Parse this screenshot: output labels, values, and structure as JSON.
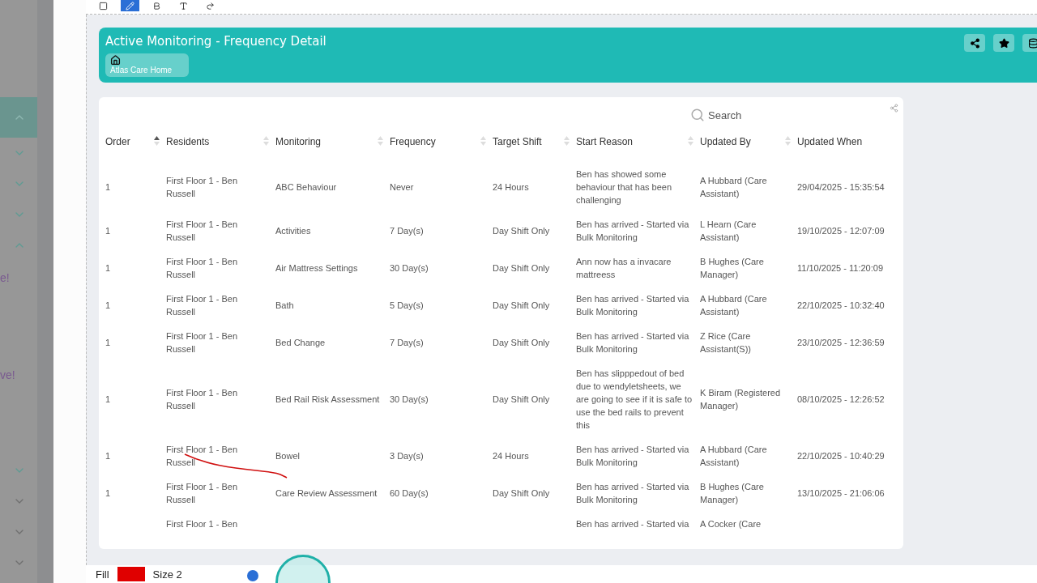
{
  "sidebar": {
    "items": [
      {
        "kind": "toggle",
        "expanded": true,
        "selected": true
      },
      {
        "kind": "toggle",
        "expanded": false,
        "selected": false
      },
      {
        "kind": "toggle",
        "expanded": false,
        "selected": false
      },
      {
        "kind": "toggle",
        "expanded": false,
        "selected": false
      },
      {
        "kind": "toggle",
        "expanded": true,
        "selected": false
      },
      {
        "kind": "text",
        "label": "e!"
      },
      {
        "kind": "text",
        "label": "ve!"
      },
      {
        "kind": "toggle",
        "expanded": false,
        "selected": false
      },
      {
        "kind": "toggle",
        "expanded": false,
        "selected": false
      },
      {
        "kind": "toggle",
        "expanded": false,
        "selected": false
      },
      {
        "kind": "toggle",
        "expanded": false,
        "selected": false
      }
    ]
  },
  "toolbar": {
    "tools": [
      {
        "kind": "square",
        "selected": false
      },
      {
        "kind": "pencil",
        "selected": true
      },
      {
        "kind": "bold",
        "selected": false
      },
      {
        "kind": "text",
        "selected": false
      },
      {
        "kind": "redo",
        "selected": false
      }
    ]
  },
  "header": {
    "title": "Active Monitoring - Frequency Detail",
    "breadcrumb": "Atlas Care Home",
    "actions": [
      {
        "kind": "share"
      },
      {
        "kind": "star"
      },
      {
        "kind": "database"
      }
    ]
  },
  "table": {
    "search": {
      "placeholder": "Search"
    },
    "columns": [
      {
        "label": "Order",
        "sorted": true
      },
      {
        "label": "Residents",
        "sorted": false
      },
      {
        "label": "Monitoring",
        "sorted": false
      },
      {
        "label": "Frequency",
        "sorted": false
      },
      {
        "label": "Target Shift",
        "sorted": false
      },
      {
        "label": "Start Reason",
        "sorted": false
      },
      {
        "label": "Updated By",
        "sorted": false
      },
      {
        "label": "Updated When"
      }
    ],
    "rows": [
      {
        "cells": [
          "1",
          "First Floor 1 - Ben Russell",
          "ABC Behaviour",
          "Never",
          "24 Hours",
          "Ben has showed some behaviour that has been challenging",
          "A Hubbard (Care Assistant)",
          "29/04/2025 - 15:35:54"
        ]
      },
      {
        "cells": [
          "1",
          "First Floor 1 - Ben Russell",
          "Activities",
          "7 Day(s)",
          "Day Shift Only",
          "Ben has arrived - Started via Bulk Monitoring",
          "L Hearn (Care Assistant)",
          "19/10/2025 - 12:07:09"
        ]
      },
      {
        "cells": [
          "1",
          "First Floor 1 - Ben Russell",
          "Air Mattress Settings",
          "30 Day(s)",
          "Day Shift Only",
          "Ann now has a invacare mattreess",
          "B Hughes (Care Manager)",
          "11/10/2025 - 11:20:09"
        ]
      },
      {
        "cells": [
          "1",
          "First Floor 1 - Ben Russell",
          "Bath",
          "5 Day(s)",
          "Day Shift Only",
          "Ben has arrived - Started via Bulk Monitoring",
          "A Hubbard (Care Assistant)",
          "22/10/2025 - 10:32:40"
        ]
      },
      {
        "cells": [
          "1",
          "First Floor 1 - Ben Russell",
          "Bed Change",
          "7 Day(s)",
          "Day Shift Only",
          "Ben has arrived - Started via Bulk Monitoring",
          "Z Rice (Care Assistant(S))",
          "23/10/2025 - 12:36:59"
        ]
      },
      {
        "cells": [
          "1",
          "First Floor 1 - Ben Russell",
          "Bed Rail Risk Assessment",
          "30 Day(s)",
          "Day Shift Only",
          "Ben has slipppedout of bed due to wendyletsheets, we are going to see if it is safe to use the bed rails to prevent this",
          "K Biram (Registered Manager)",
          "08/10/2025 - 12:26:52"
        ]
      },
      {
        "cells": [
          "1",
          "First Floor 1 - Ben Russell",
          "Bowel",
          "3 Day(s)",
          "24 Hours",
          "Ben has arrived - Started via Bulk Monitoring",
          "A Hubbard (Care Assistant)",
          "22/10/2025 - 10:40:29"
        ]
      },
      {
        "cells": [
          "1",
          "First Floor 1 - Ben Russell",
          "Care Review Assessment",
          "60 Day(s)",
          "Day Shift Only",
          "Ben has arrived - Started via Bulk Monitoring",
          "B Hughes (Care Manager)",
          "13/10/2025 - 21:06:06"
        ]
      },
      {
        "cells": [
          null,
          "First Floor 1 - Ben",
          null,
          null,
          null,
          "Ben has arrived - Started via",
          "A Cocker (Care",
          null
        ]
      }
    ]
  },
  "bottom_bar": {
    "fill_label": "Fill",
    "color": "#e00000",
    "size_label": "Size 2"
  }
}
